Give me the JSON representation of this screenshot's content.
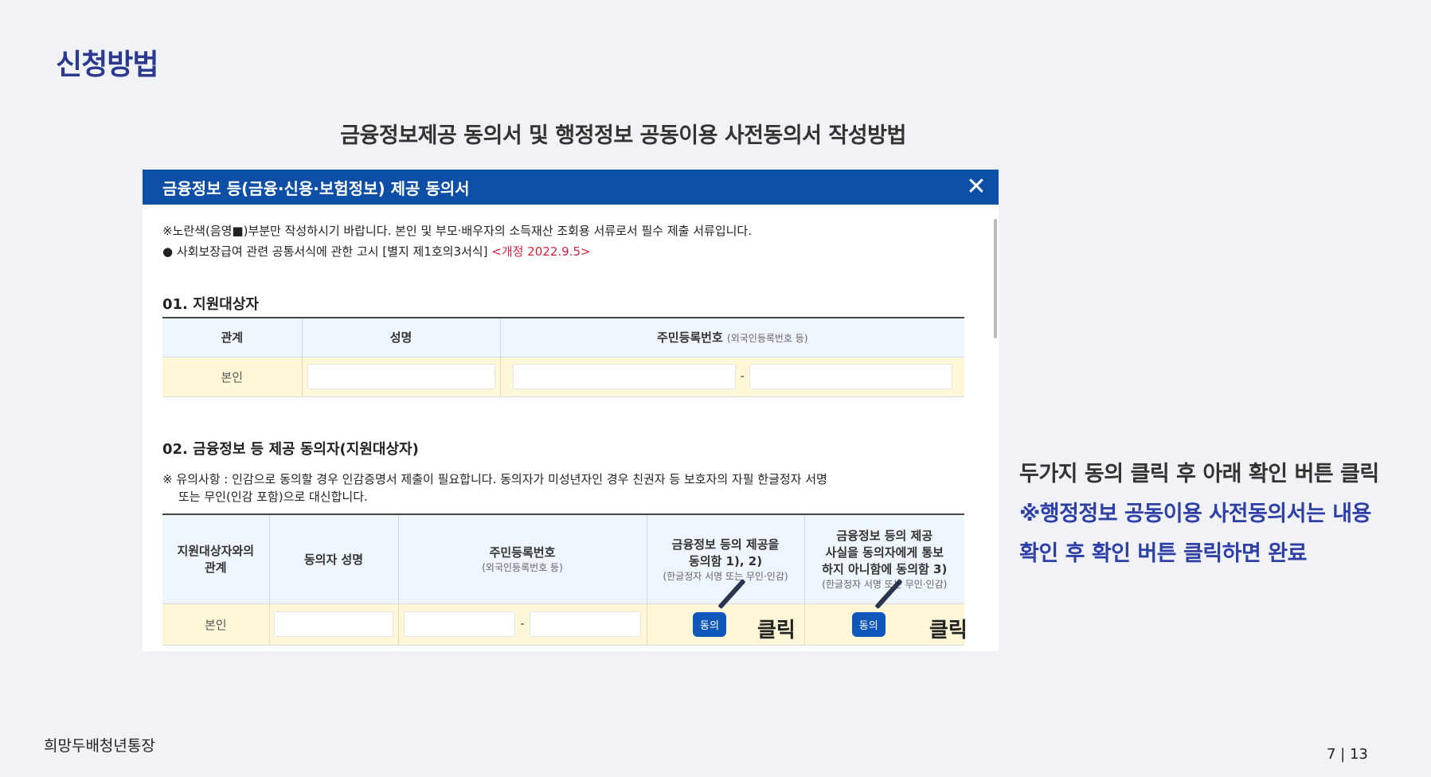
{
  "page": {
    "section_title": "신청방법",
    "heading": "금융정보제공 동의서 및 행정정보 공동이용 사전동의서 작성방법"
  },
  "dialog": {
    "title": "금융정보 등(금융·신용·보험정보) 제공 동의서",
    "close_icon": "✕",
    "notice1": "※노란색(음영■)부분만 작성하시기 바랍니다. 본인 및 부모·배우자의 소득재산 조회용 서류로서 필수 제출 서류입니다.",
    "notice2_prefix": "● 사회보장급여 관련 공통서식에 관한 고시 [별지 제1호의3서식]",
    "notice2_revision": "<개정 2022.9.5>",
    "section1": {
      "title": "01. 지원대상자",
      "headers": [
        "관계",
        "성명",
        "주민등록번호"
      ],
      "header_id_note": "(외국인등록번호 등)",
      "row": {
        "relation": "본인",
        "name": "",
        "id_sep": "-"
      }
    },
    "section2": {
      "title": "02. 금융정보 등 제공 동의자(지원대상자)",
      "caution_line1": "※ 유의사항 : 인감으로 동의할 경우 인감증명서 제출이 필요합니다. 동의자가 미성년자인 경우 친권자 등 보호자의 자필 한글정자 서명",
      "caution_line2": "또는 무인(인감 포함)으로 대신합니다.",
      "headers": {
        "relation_line1": "지원대상자와의",
        "relation_line2": "관계",
        "name": "동의자 성명",
        "id": "주민등록번호",
        "id_note": "(외국인등록번호 등)",
        "consent1_line1": "금융정보 등의 제공을",
        "consent1_line2": "동의함 1), 2)",
        "consent1_note": "(한글정자 서명 또는 무인·인감)",
        "consent2_line1": "금융정보 등의 제공",
        "consent2_line2": "사실을 동의자에게 통보",
        "consent2_line3": "하지 아니함에 동의함 3)",
        "consent2_note": "(한글정자 서명 또는 무인·인감)"
      },
      "row": {
        "relation": "본인",
        "id_sep": "-",
        "agree1": "동의",
        "agree2": "동의"
      },
      "click1": "클릭",
      "click2": "클릭"
    }
  },
  "side": {
    "line1": "두가지 동의 클릭 후 아래 확인 버튼 클릭",
    "line2": "※행정정보 공동이용 사전동의서는 내용",
    "line3": "확인 후 확인 버튼 클릭하면 완료"
  },
  "footer": {
    "brand": "희망두배청년통장",
    "page_num": "7 | 13"
  }
}
